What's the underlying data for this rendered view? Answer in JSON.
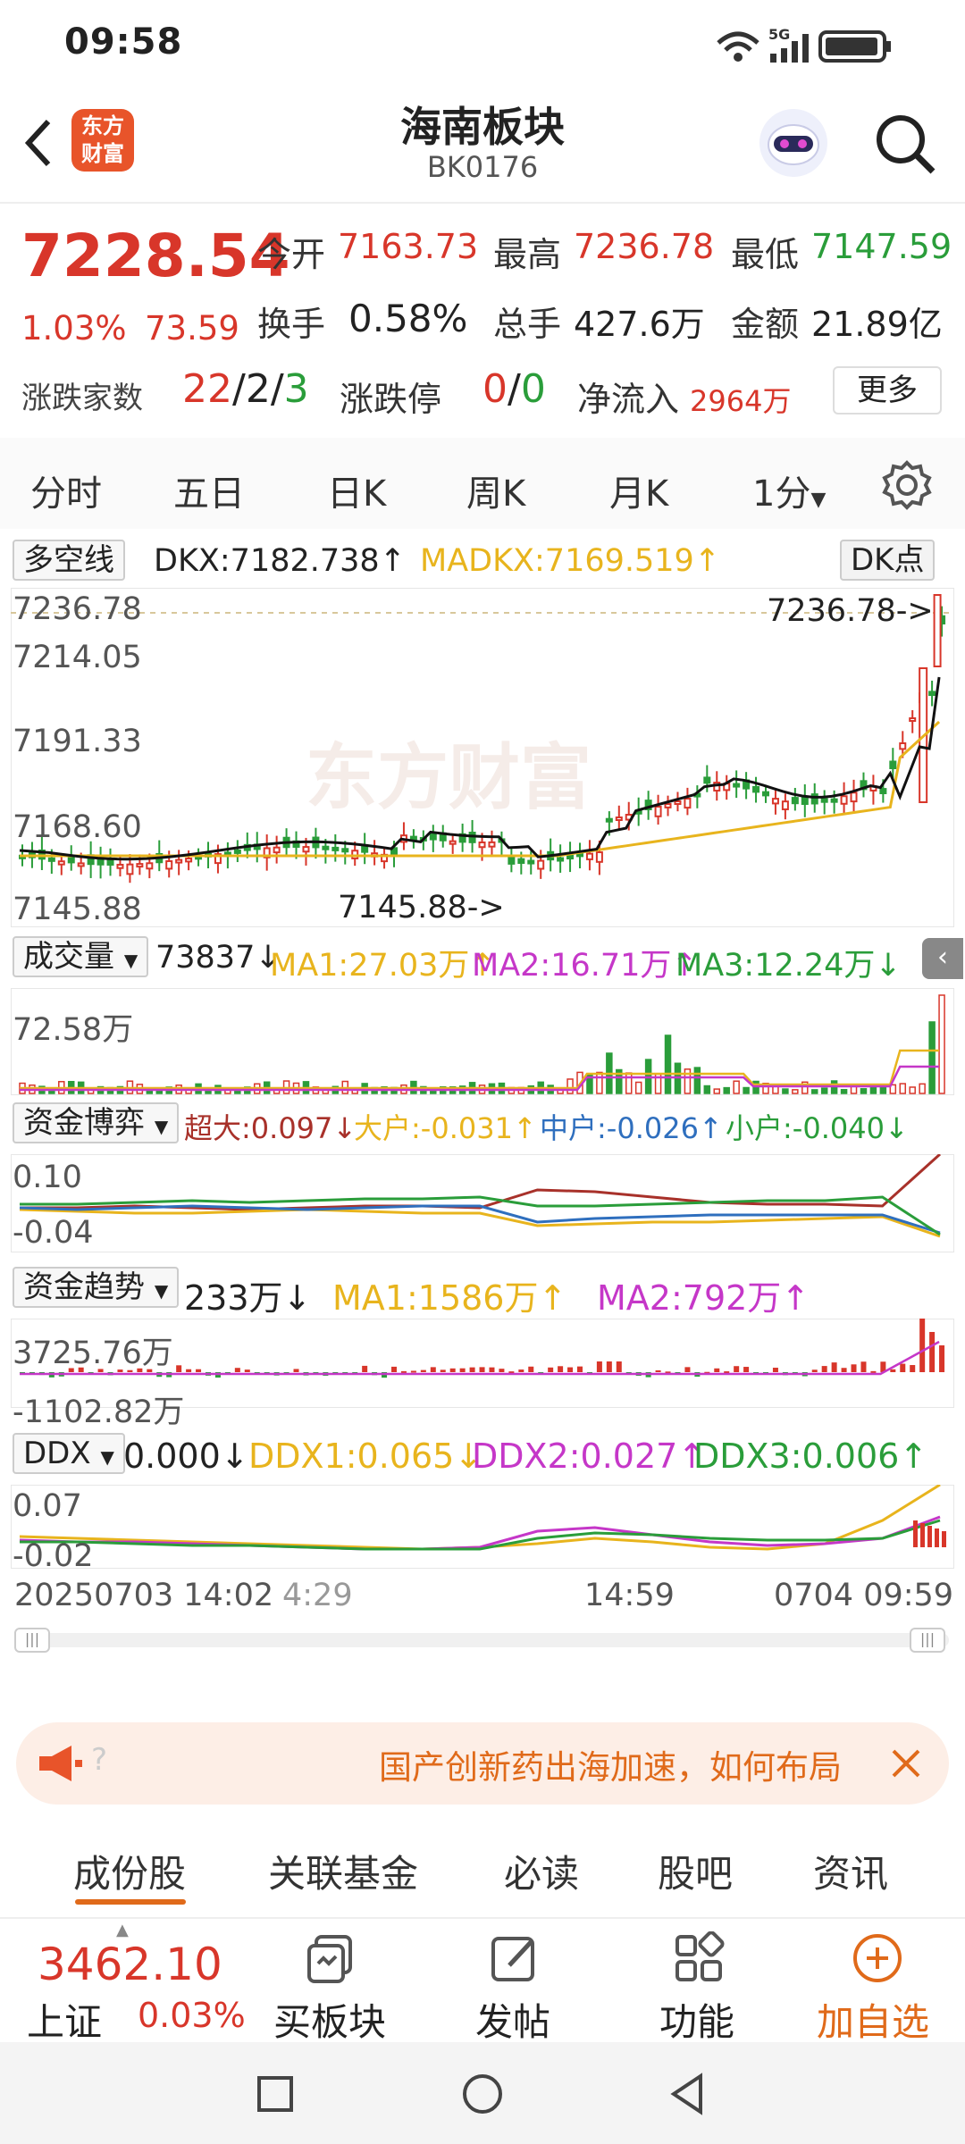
{
  "status": {
    "time": "09:58"
  },
  "header": {
    "title": "海南板块",
    "code": "BK0176",
    "logo": "东方财富"
  },
  "quote": {
    "price": "7228.54",
    "pct": "1.03%",
    "chg": "73.59",
    "open_label": "今开",
    "open": "7163.73",
    "high_label": "最高",
    "high": "7236.78",
    "low_label": "最低",
    "low": "7147.59",
    "turnover_label": "换手",
    "turnover": "0.58%",
    "volume_label": "总手",
    "volume": "427.6万",
    "amount_label": "金额",
    "amount": "21.89亿",
    "updown_label": "涨跌家数",
    "up": "22",
    "flat": "2",
    "down": "3",
    "sep": "/",
    "limit_label": "涨跌停",
    "limit_up": "0",
    "limit_down": "0",
    "inflow_label": "净流入",
    "inflow": "2964万",
    "more": "更多"
  },
  "tabs": [
    "分时",
    "五日",
    "日K",
    "周K",
    "月K"
  ],
  "tab_active": "1分",
  "dk": {
    "selector": "多空线",
    "dkx": "DKX:7182.738",
    "madkx": "MADKX:7169.519",
    "button": "DK点"
  },
  "price_axis": [
    "7236.78",
    "7214.05",
    "7191.33",
    "7168.60",
    "7145.88"
  ],
  "price_marks": {
    "high": "7236.78->",
    "low": "7145.88->"
  },
  "vol": {
    "selector": "成交量",
    "value": "73837",
    "ma1": "MA1:27.03万",
    "ma2": "MA2:16.71万",
    "ma3": "MA3:12.24万",
    "axis": "72.58万"
  },
  "fund": {
    "selector": "资金博弈",
    "super": "超大:0.097",
    "big": "大户:-0.031",
    "mid": "中户:-0.026",
    "small": "小户:-0.040",
    "axis_top": "0.10",
    "axis_bot": "-0.04"
  },
  "trend": {
    "selector": "资金趋势",
    "value": "233万",
    "ma1": "MA1:1586万",
    "ma2": "MA2:792万",
    "axis_top": "3725.76万",
    "axis_bot": "-1102.82万"
  },
  "ddx": {
    "selector": "DDX",
    "value": "0.000",
    "ddx1": "DDX1:0.065",
    "ddx2": "DDX2:0.027",
    "ddx3": "DDX3:0.006",
    "axis_top": "0.07",
    "axis_bot": "-0.02"
  },
  "time_axis": [
    "20250703 14:02",
    "4:29",
    "14:59",
    "0704 09:59"
  ],
  "banner": {
    "text": "国产创新药出海加速，如何布局"
  },
  "bottom_tabs": [
    "成份股",
    "关联基金",
    "必读",
    "股吧",
    "资讯"
  ],
  "bottom_bar": {
    "index_value": "3462.10",
    "index_name": "上证",
    "index_pct": "0.03%",
    "buy": "买板块",
    "post": "发帖",
    "func": "功能",
    "add": "加自选"
  },
  "colors": {
    "up": "#d8362a",
    "down": "#2a9d3a",
    "accent": "#e06a1a"
  }
}
